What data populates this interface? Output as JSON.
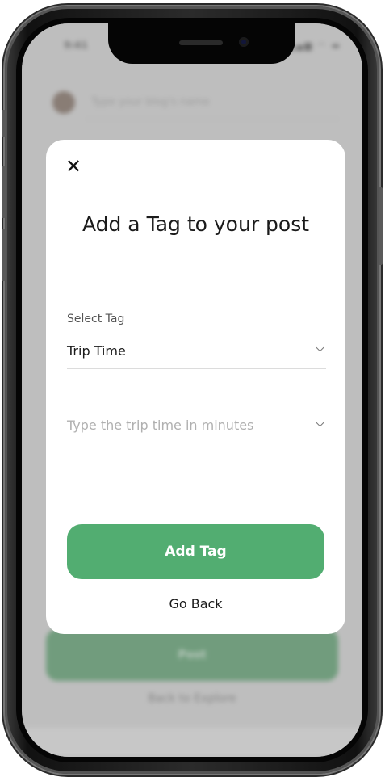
{
  "status_bar": {
    "time": "9:41",
    "icons": "▂▄▆ ◠ ▬"
  },
  "background": {
    "input_placeholder": "Type your blog's name",
    "post_button": "Post",
    "back_link": "Back to Explore"
  },
  "modal": {
    "title": "Add a Tag to your post",
    "select_label": "Select Tag",
    "select_value": "Trip Time",
    "input_placeholder": "Type the trip time in minutes",
    "add_button": "Add Tag",
    "go_back": "Go Back",
    "close_icon": "close-icon",
    "accent_color": "#52ad71"
  }
}
